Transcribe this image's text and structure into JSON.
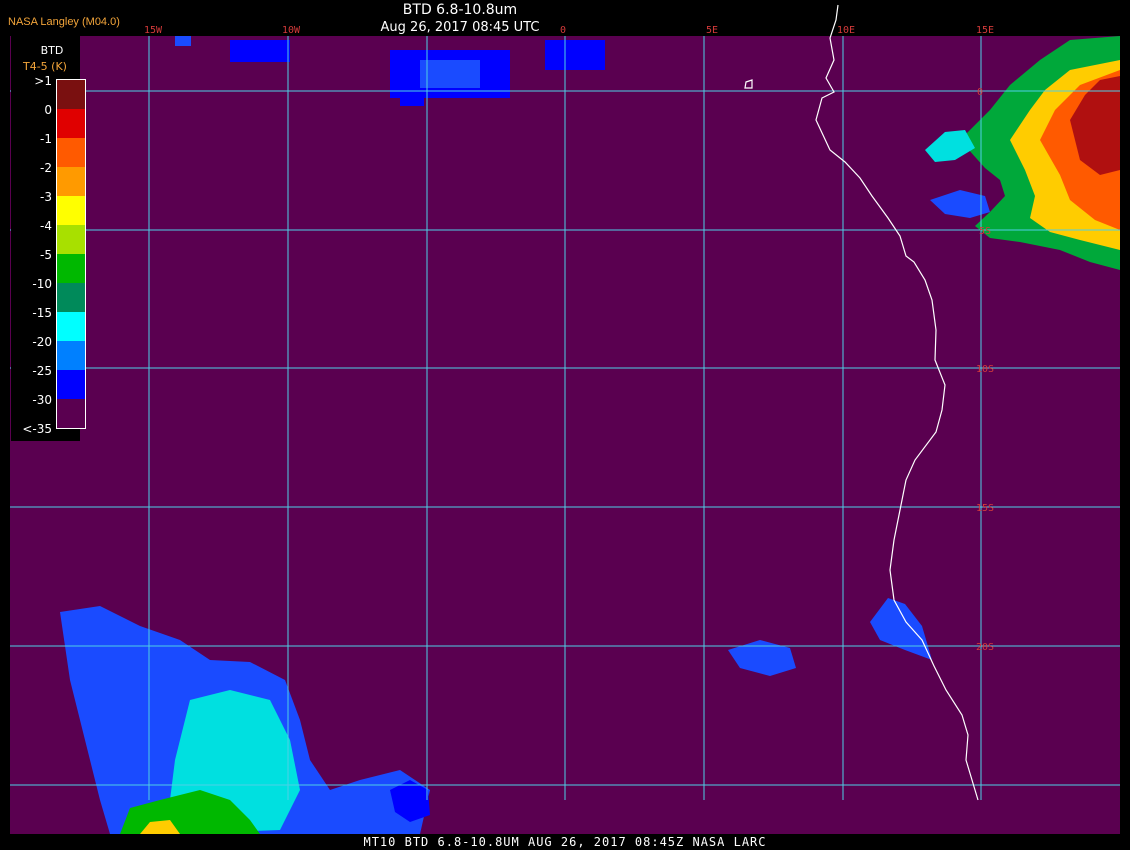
{
  "header": {
    "credit": "NASA Langley (M04.0)",
    "title": "BTD 6.8-10.8um",
    "subtitle": "Aug 26, 2017 08:45 UTC"
  },
  "footer": "MT10  BTD 6.8-10.8UM  AUG 26, 2017 08:45Z  NASA LARC",
  "legend": {
    "title": "BTD",
    "units": "T4-5 (K)",
    "labels": [
      ">1",
      "0",
      "-1",
      "-2",
      "-3",
      "-4",
      "-5",
      "-10",
      "-15",
      "-20",
      "-25",
      "-30",
      "<-35"
    ],
    "colors": [
      "#7a1010",
      "#e00000",
      "#ff5a00",
      "#ff9a00",
      "#ffff00",
      "#a8e000",
      "#00b800",
      "#008a5a",
      "#00ffff",
      "#0080ff",
      "#0000ff",
      "#5a0050"
    ]
  },
  "map": {
    "background": "#5a0050",
    "grid_color": "#4ecfe6",
    "coast_color": "#ffffff",
    "lon_labels": [
      "15W",
      "10W",
      "5W",
      "0",
      "5E",
      "10E",
      "15E"
    ],
    "lat_labels": [
      "0",
      "5S",
      "10S",
      "15S",
      "20S"
    ]
  }
}
